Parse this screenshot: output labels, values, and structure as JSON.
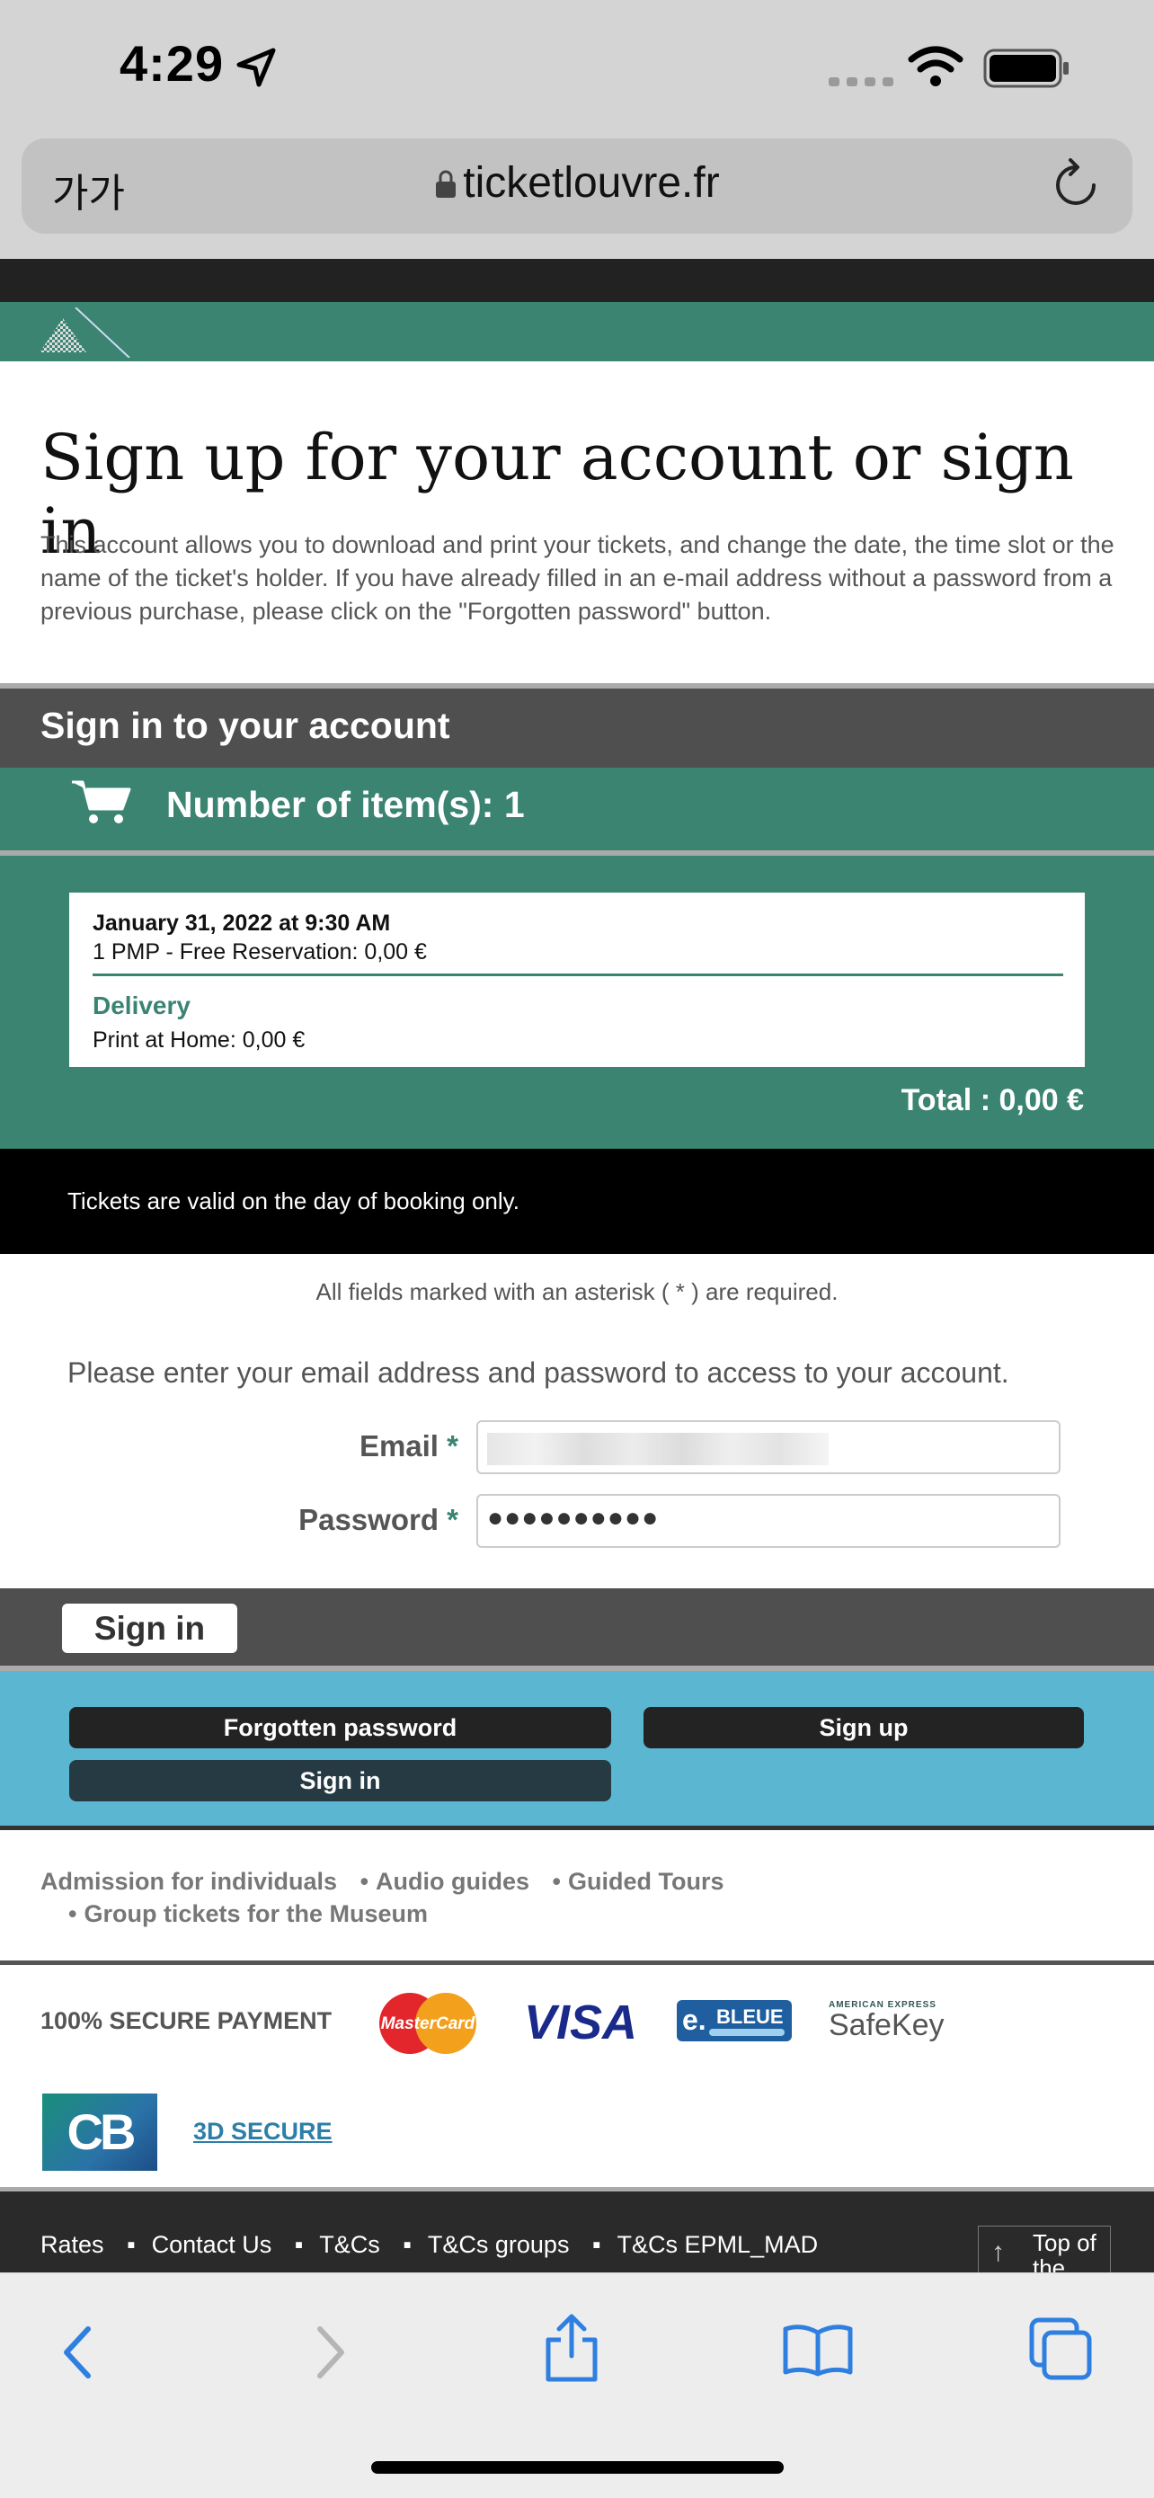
{
  "status_bar": {
    "time": "4:29"
  },
  "browser": {
    "text_size_label": "가가",
    "url": "ticketlouvre.fr"
  },
  "page": {
    "title": "Sign up for your account or sign in",
    "intro": "This account allows you to download and print your tickets, and change the date, the time slot or the name of the ticket's holder. If you have already filled in an e-mail address without a password from a previous purchase, please click on the \"Forgotten password\" button."
  },
  "sign_in_section": {
    "header": "Sign in to your account"
  },
  "cart": {
    "items_label": "Number of item(s): 1",
    "date": "January 31, 2022 at 9:30 AM",
    "item_line": "1  PMP - Free Reservation:  0,00 €",
    "delivery_heading": "Delivery",
    "delivery_line": "Print at Home:  0,00 €",
    "total": "Total : 0,00 €"
  },
  "notice": "Tickets are valid on the day of booking only.",
  "form": {
    "required_note": "All fields marked with an asterisk ( * ) are required.",
    "instruction": "Please enter your email address and password to access to your account.",
    "email_label": "Email",
    "password_label": "Password",
    "asterisk": "*",
    "password_value": "●●●●●●●●●●"
  },
  "buttons": {
    "sign_in_main": "Sign in",
    "forgotten_password": "Forgotten password",
    "sign_up": "Sign up",
    "sign_in_small": "Sign in"
  },
  "footer_links_row1": [
    "Admission for individuals",
    "Audio guides",
    "Guided Tours"
  ],
  "footer_links_row2": [
    "Group tickets for the Museum"
  ],
  "payment": {
    "secure_label": "100% SECURE PAYMENT",
    "mastercard": "MasterCard",
    "visa": "VISA",
    "ebleue_e": "e.",
    "ebleue": "BLEUE",
    "amex_small": "AMERICAN EXPRESS",
    "safekey": "SafeKey",
    "cb": "CB",
    "three_d": "3D SECURE"
  },
  "footer": {
    "links": [
      "Rates",
      "Contact Us",
      "T&Cs",
      "T&Cs groups",
      "T&Cs EPML_MAD"
    ],
    "top_of_page": "Top of the"
  },
  "colors": {
    "green": "#3a8471",
    "blue": "#5bb7d1",
    "dark": "#4f4f4f",
    "link": "#2d7fa8"
  }
}
